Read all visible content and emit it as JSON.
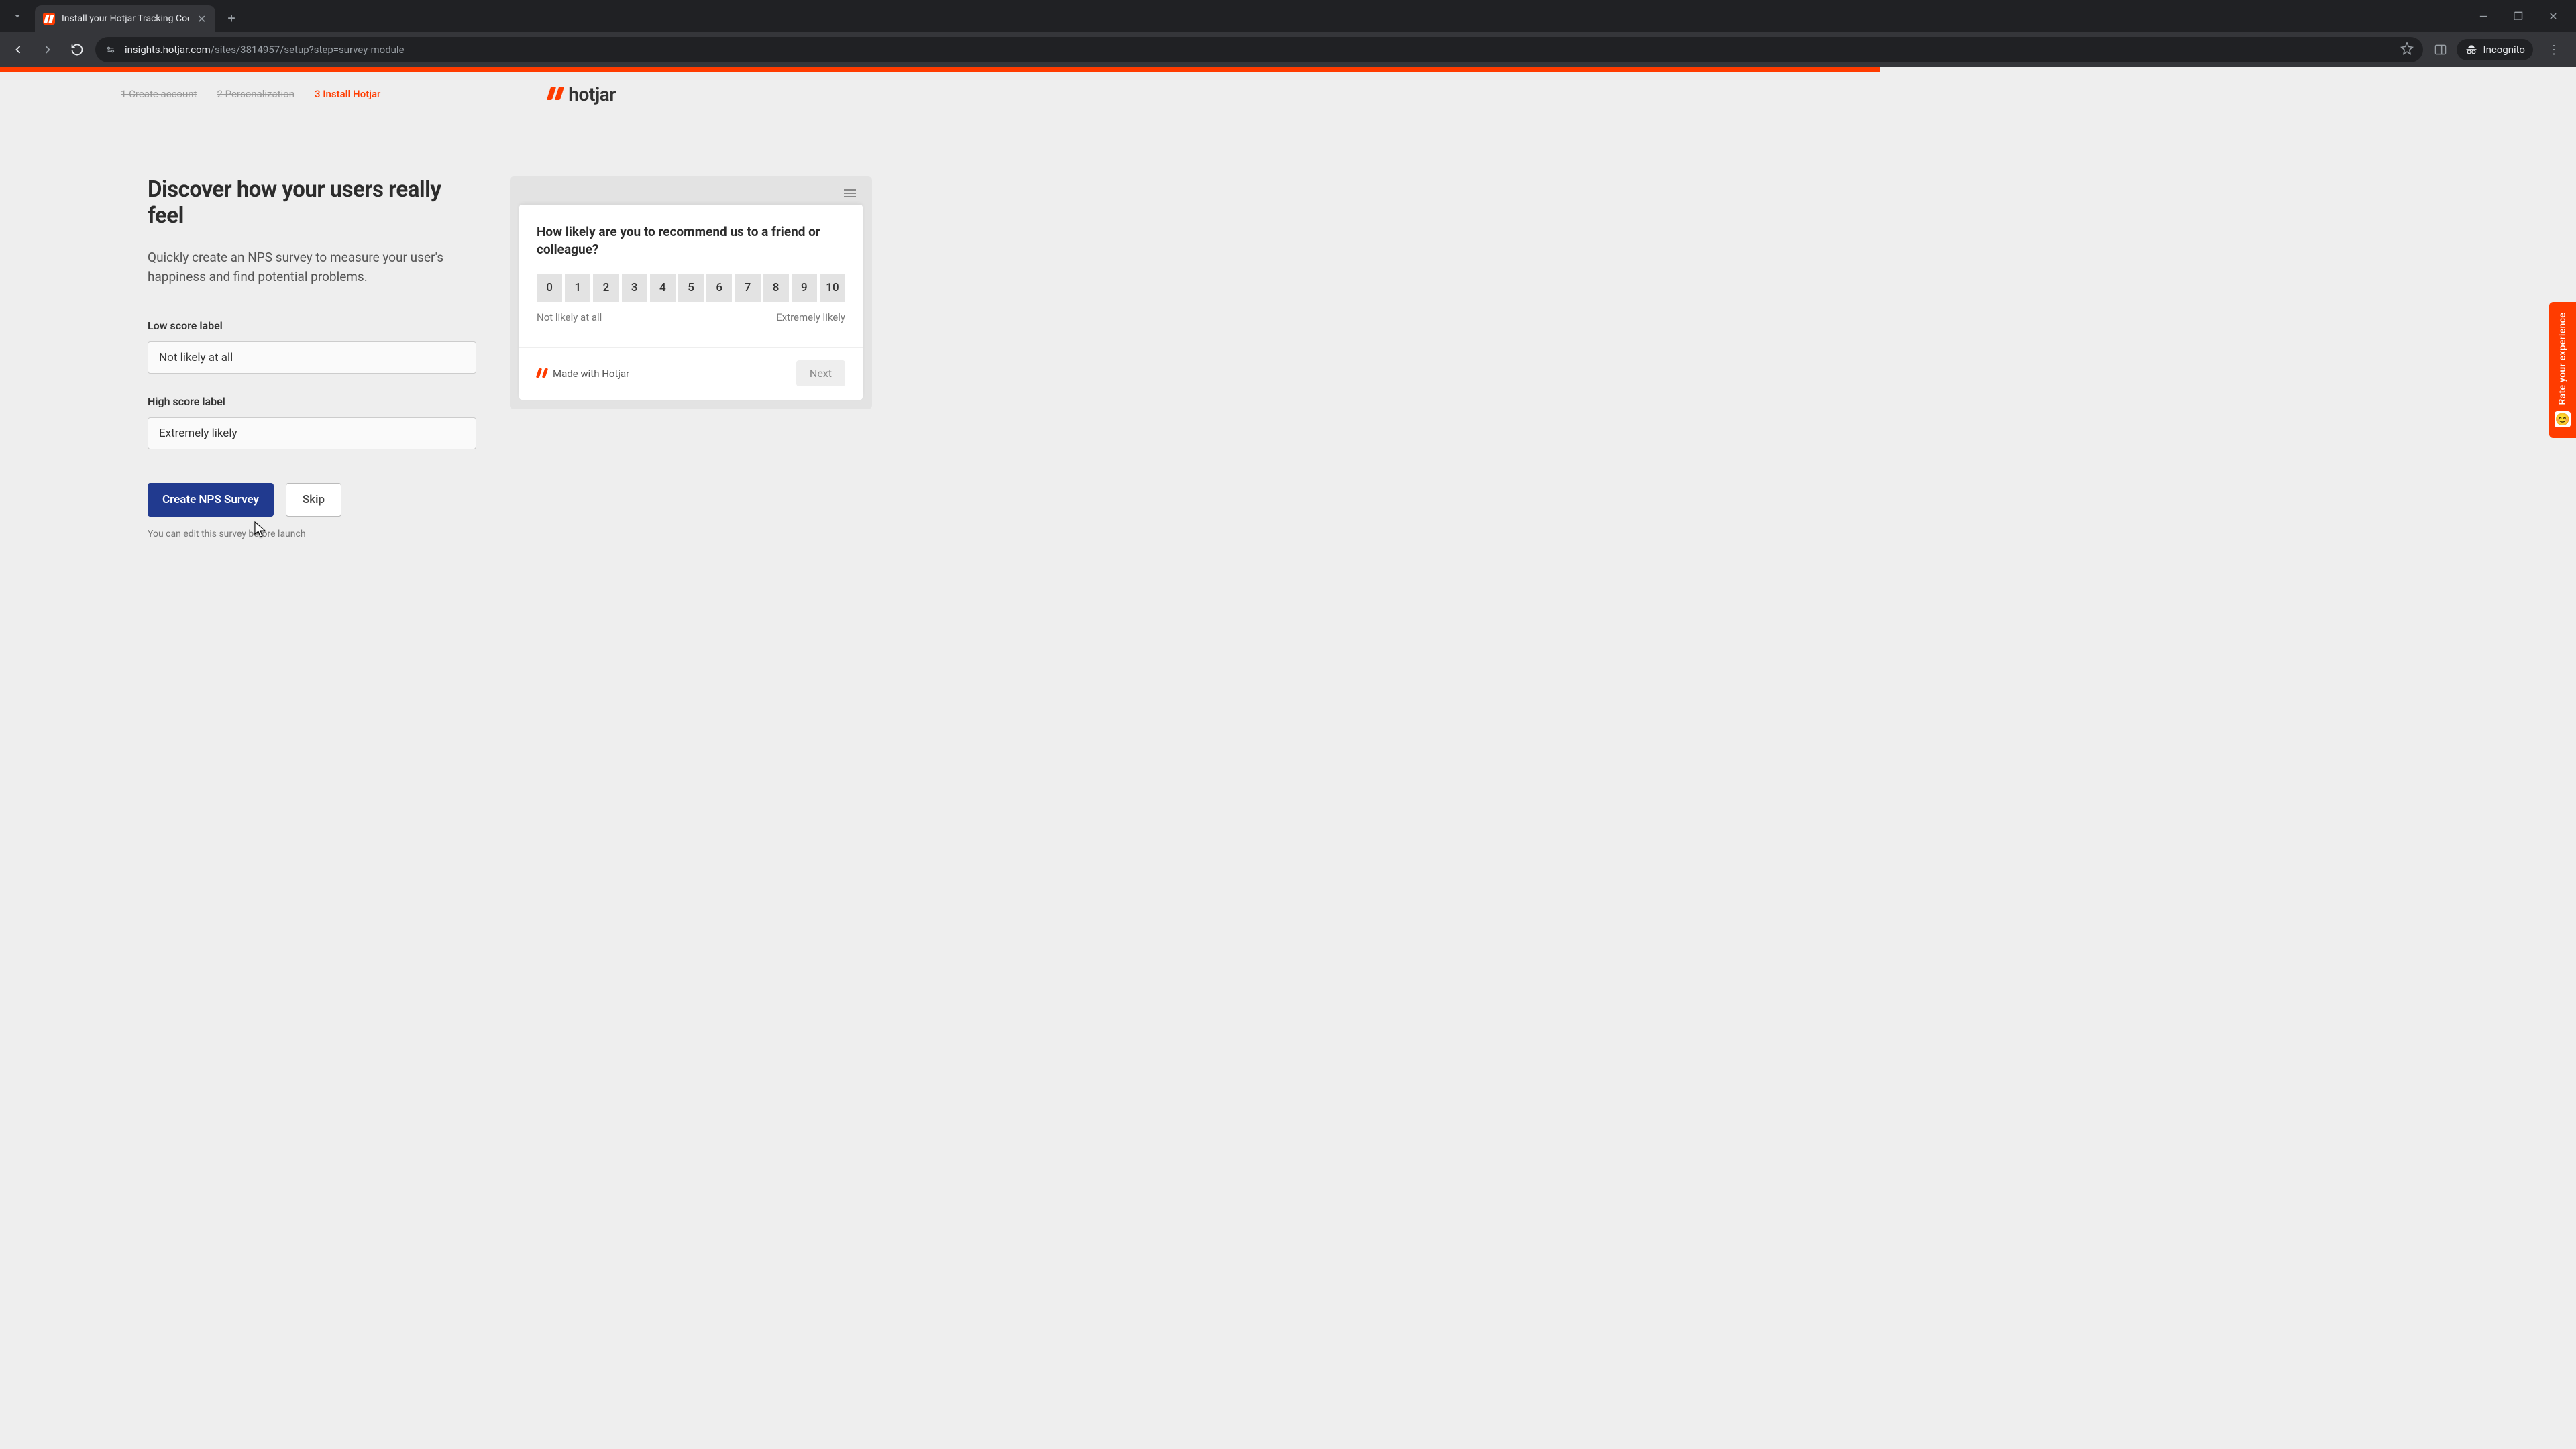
{
  "browser": {
    "tab_title": "Install your Hotjar Tracking Cod",
    "url_host": "insights.hotjar.com",
    "url_path": "/sites/3814957/setup?step=survey-module",
    "incognito_label": "Incognito"
  },
  "progress_percent": 73,
  "steps": [
    {
      "label": "1 Create account",
      "state": "done"
    },
    {
      "label": "2 Personalization",
      "state": "done"
    },
    {
      "label": "3 Install Hotjar",
      "state": "active"
    }
  ],
  "brand": "hotjar",
  "main": {
    "heading": "Discover how your users really feel",
    "subheading": "Quickly create an NPS survey to measure your user's happiness and find potential problems.",
    "low_label": "Low score label",
    "low_value": "Not likely at all",
    "high_label": "High score label",
    "high_value": "Extremely likely",
    "create_button": "Create NPS Survey",
    "skip_button": "Skip",
    "hint": "You can edit this survey before launch"
  },
  "preview": {
    "question": "How likely are you to recommend us to a friend or colleague?",
    "scale": [
      "0",
      "1",
      "2",
      "3",
      "4",
      "5",
      "6",
      "7",
      "8",
      "9",
      "10"
    ],
    "low_text": "Not likely at all",
    "high_text": "Extremely likely",
    "made_with": "Made with Hotjar",
    "next": "Next"
  },
  "feedback_tab": "Rate your experience"
}
